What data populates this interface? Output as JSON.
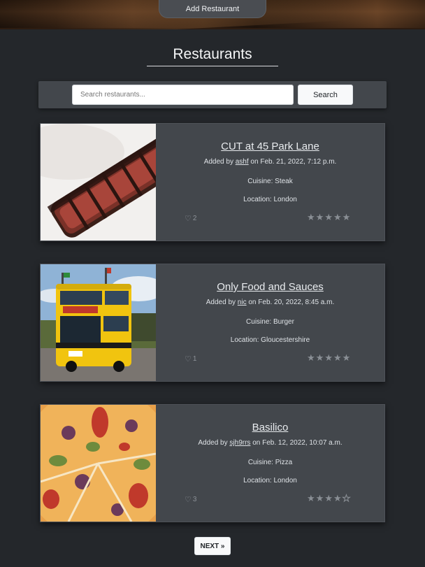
{
  "header": {
    "add_button": "Add Restaurant"
  },
  "page_title": "Restaurants",
  "search": {
    "placeholder": "Search restaurants...",
    "button": "Search"
  },
  "restaurants": [
    {
      "name": "CUT at 45 Park Lane",
      "added_prefix": "Added by ",
      "user": "ashf",
      "added_suffix": " on Feb. 21, 2022, 7:12 p.m.",
      "cuisine": "Cuisine: Steak",
      "location": "Location: London",
      "likes": "2",
      "rating": 5,
      "image": "steak-photo"
    },
    {
      "name": "Only Food and Sauces",
      "added_prefix": "Added by ",
      "user": "nic",
      "added_suffix": " on Feb. 20, 2022, 8:45 a.m.",
      "cuisine": "Cuisine: Burger",
      "location": "Location: Gloucestershire",
      "likes": "1",
      "rating": 5,
      "image": "bus-photo"
    },
    {
      "name": "Basilico",
      "added_prefix": "Added by ",
      "user": "sjh9rrs",
      "added_suffix": " on Feb. 12, 2022, 10:07 a.m.",
      "cuisine": "Cuisine: Pizza",
      "location": "Location: London",
      "likes": "3",
      "rating": 4,
      "image": "pizza-photo"
    }
  ],
  "pagination": {
    "next": "NEXT »"
  }
}
